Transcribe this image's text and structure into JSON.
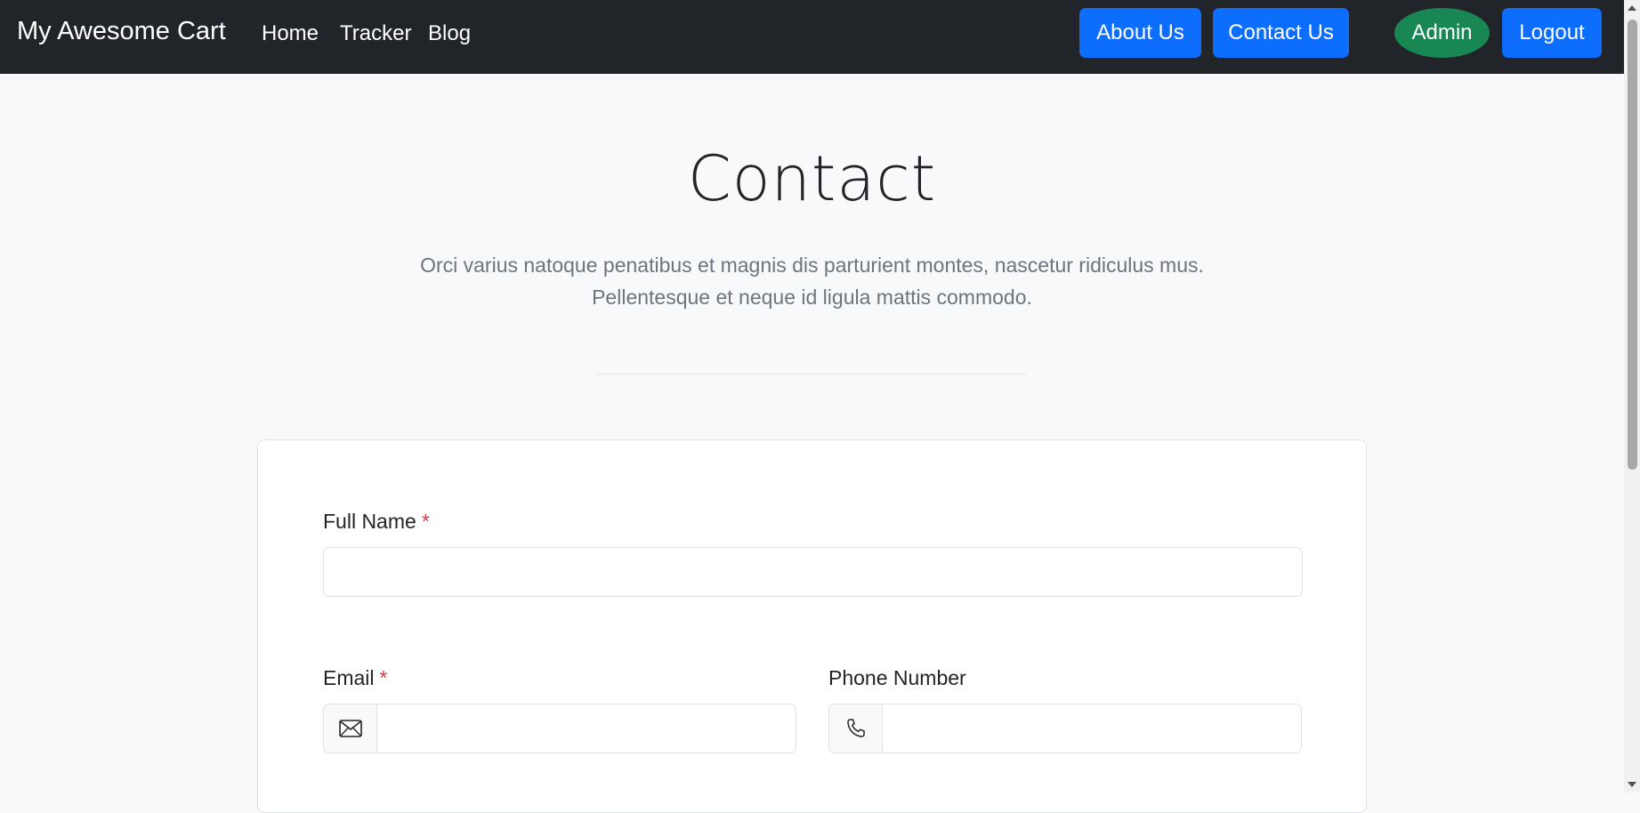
{
  "navbar": {
    "brand": "My Awesome Cart",
    "links": [
      "Home",
      "Tracker",
      "Blog"
    ],
    "about_label": "About Us",
    "contact_label": "Contact Us",
    "admin_label": "Admin",
    "logout_label": "Logout"
  },
  "colors": {
    "navbar_bg": "#212529",
    "primary": "#0d6efd",
    "success": "#198754",
    "required": "#dc3545",
    "muted": "#6c757d"
  },
  "hero": {
    "title": "Contact",
    "subtitle_line1": "Orci varius natoque penatibus et magnis dis parturient montes, nascetur ridiculus mus.",
    "subtitle_line2": "Pellentesque et neque id ligula mattis commodo."
  },
  "form": {
    "full_name_label": "Full Name",
    "email_label": "Email",
    "phone_label": "Phone Number",
    "required_mark": "*",
    "full_name_value": "",
    "email_value": "",
    "phone_value": "",
    "email_icon": "envelope-icon",
    "phone_icon": "telephone-icon"
  }
}
